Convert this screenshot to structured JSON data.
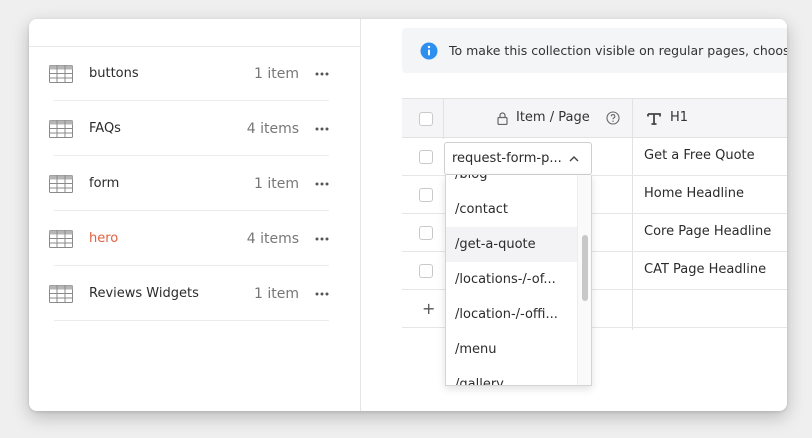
{
  "sidebar": {
    "collections": [
      {
        "name": "buttons",
        "count": "1 item",
        "active": false
      },
      {
        "name": "FAQs",
        "count": "4 items",
        "active": false
      },
      {
        "name": "form",
        "count": "1 item",
        "active": false
      },
      {
        "name": "hero",
        "count": "4 items",
        "active": true
      },
      {
        "name": "Reviews Widgets",
        "count": "1 item",
        "active": false
      }
    ]
  },
  "banner": {
    "text": "To make this collection visible on regular pages, choose",
    "icon": "info-icon"
  },
  "grid": {
    "headers": {
      "item_page": "Item / Page",
      "h1": "H1"
    },
    "rows": [
      {
        "h1": "Get a Free Quote"
      },
      {
        "h1": "Home Headline"
      },
      {
        "h1": "Core Page Headline"
      },
      {
        "h1": "CAT Page Headline"
      }
    ],
    "add_row": "+"
  },
  "page_select": {
    "value": "request-form-p...",
    "options": [
      "/blog",
      "/contact",
      "/get-a-quote",
      "/locations-/-of...",
      "/location-/-offi...",
      "/menu",
      "/gallery"
    ],
    "hovered": "/get-a-quote"
  },
  "colors": {
    "accent": "#e2603f",
    "info": "#2d8ff0"
  }
}
